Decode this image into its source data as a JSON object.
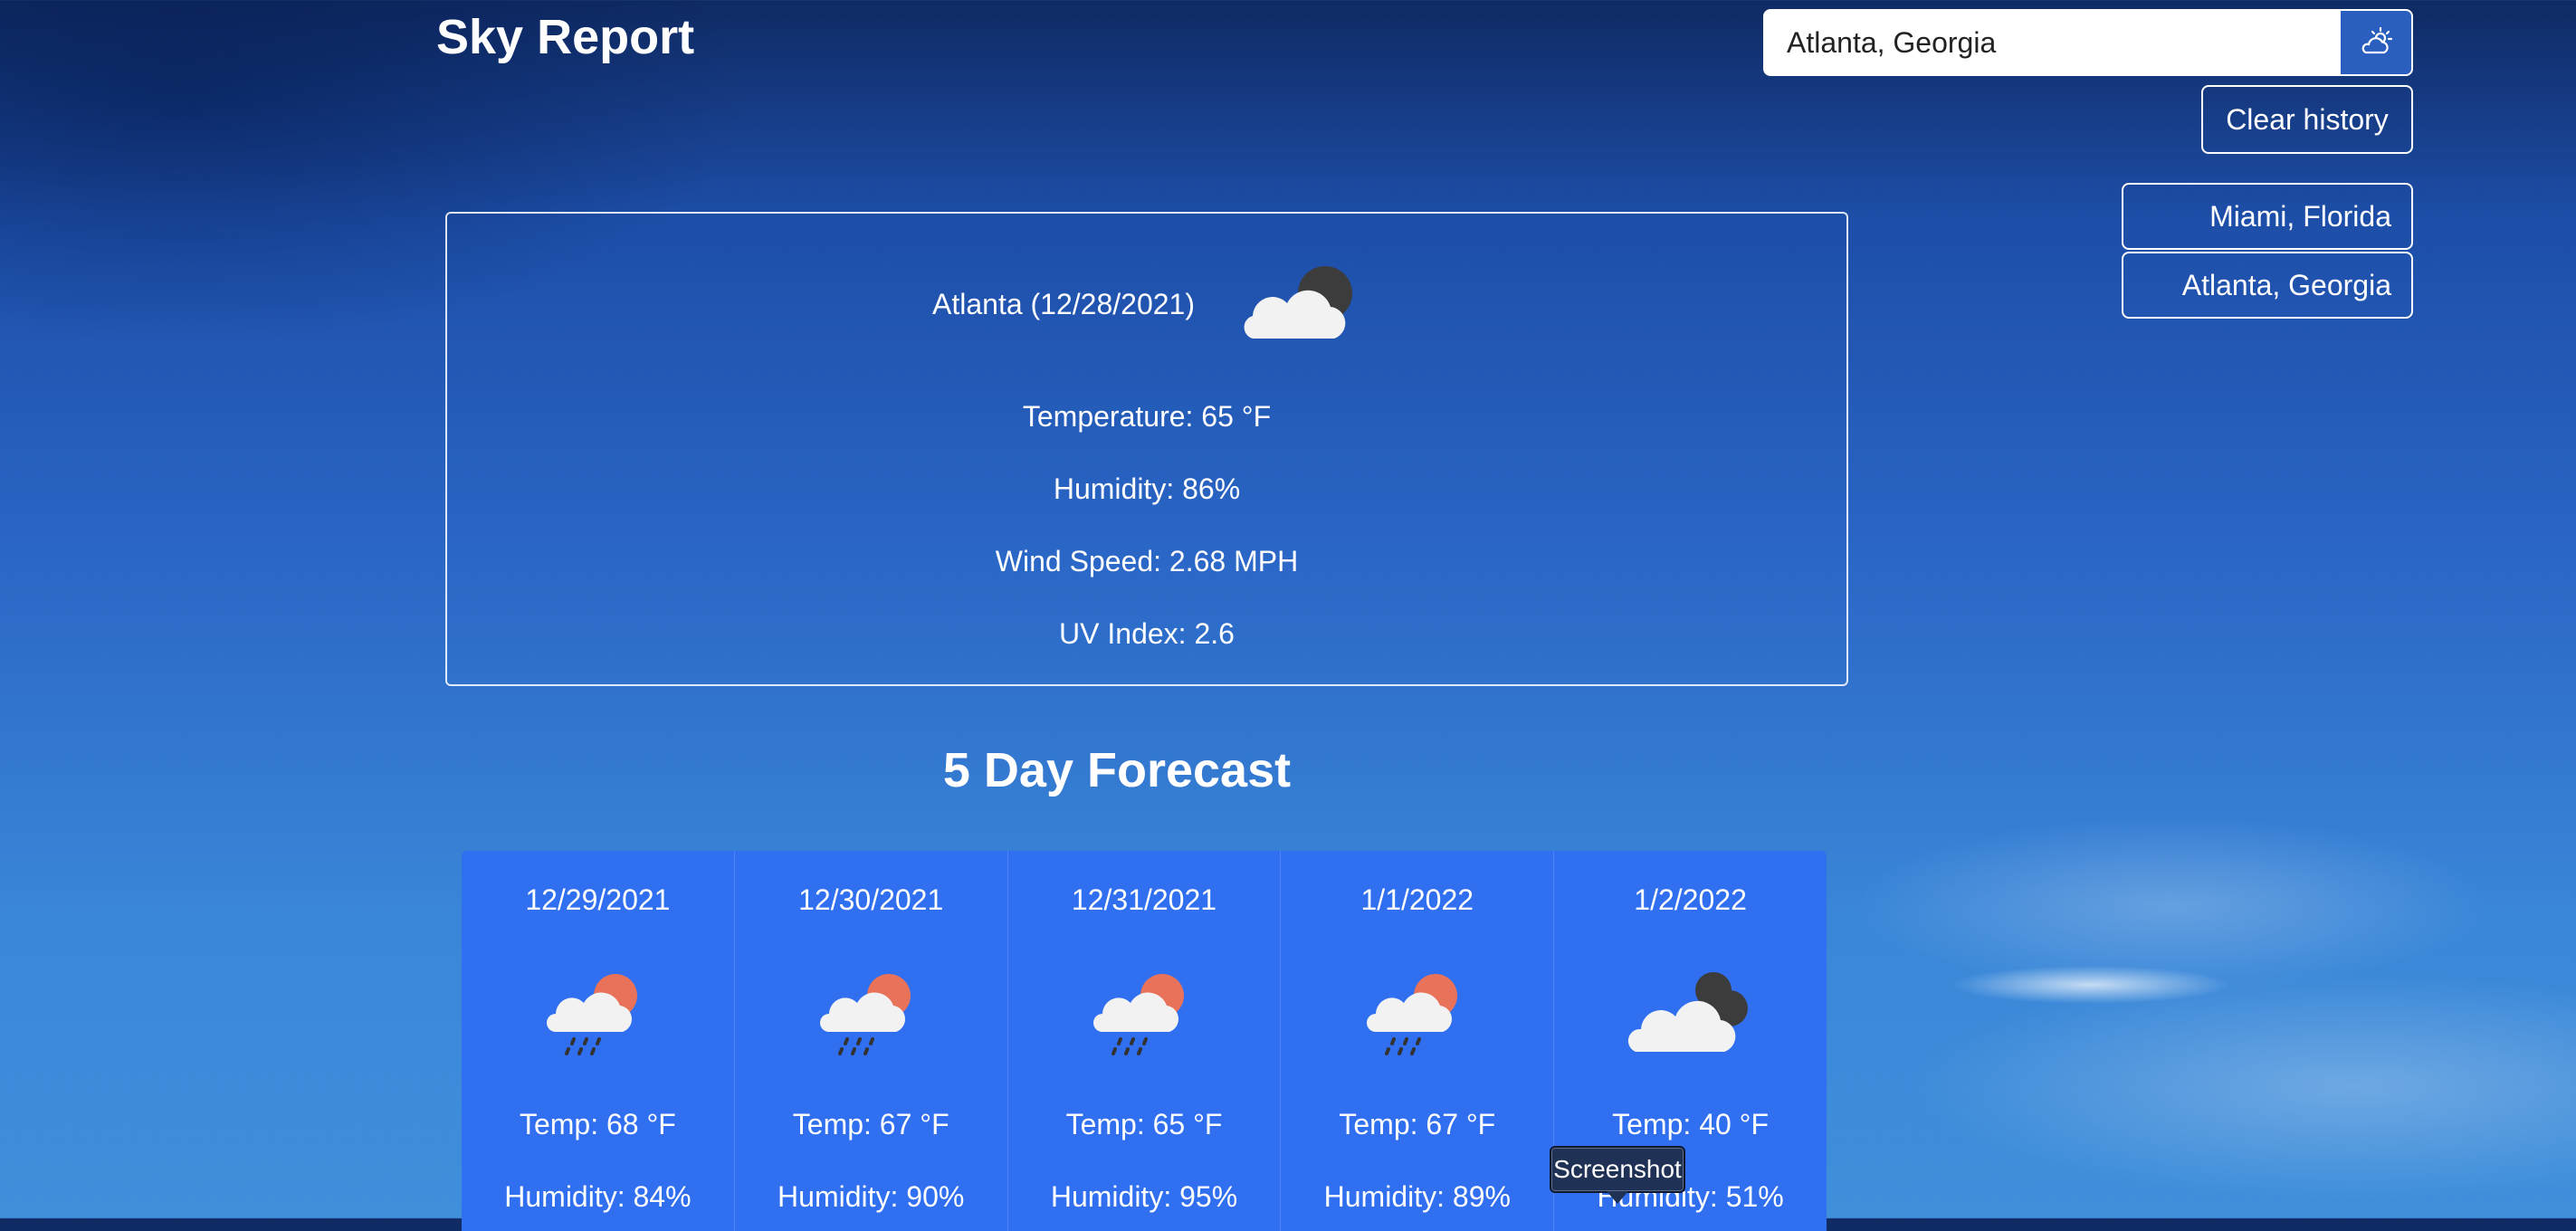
{
  "app": {
    "title": "Sky Report"
  },
  "search": {
    "value": "Atlanta, Georgia",
    "button_icon": "partly-cloudy-icon"
  },
  "history": {
    "clear_label": "Clear history",
    "items": [
      {
        "label": "Miami, Florida"
      },
      {
        "label": "Atlanta, Georgia"
      }
    ]
  },
  "current": {
    "heading": "Atlanta (12/28/2021)",
    "icon": "cloudy-night-icon",
    "temperature": "Temperature: 65 °F",
    "humidity": "Humidity: 86%",
    "wind": "Wind Speed: 2.68 MPH",
    "uv": "UV Index: 2.6"
  },
  "forecast": {
    "title": "5 Day Forecast",
    "days": [
      {
        "date": "12/29/2021",
        "icon": "rain-sun-icon",
        "temp": "Temp: 68 °F",
        "humidity": "Humidity: 84%"
      },
      {
        "date": "12/30/2021",
        "icon": "rain-sun-icon",
        "temp": "Temp: 67 °F",
        "humidity": "Humidity: 90%"
      },
      {
        "date": "12/31/2021",
        "icon": "rain-sun-icon",
        "temp": "Temp: 65 °F",
        "humidity": "Humidity: 95%"
      },
      {
        "date": "1/1/2022",
        "icon": "rain-sun-icon",
        "temp": "Temp: 67 °F",
        "humidity": "Humidity: 89%"
      },
      {
        "date": "1/2/2022",
        "icon": "cloudy-night-icon",
        "temp": "Temp: 40 °F",
        "humidity": "Humidity: 51%"
      }
    ]
  },
  "tooltip": {
    "label": "Screenshot"
  },
  "colors": {
    "card_blue": "#2f6ff0",
    "sun": "#e8735a",
    "moon": "#3c3c3c",
    "cloud": "#f2f2f2"
  }
}
